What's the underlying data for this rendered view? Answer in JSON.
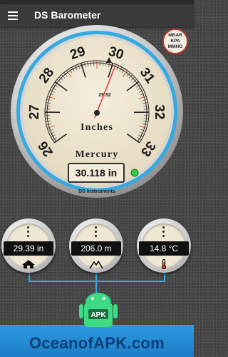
{
  "app_bar": {
    "title": "DS Barometer",
    "menu_icon": "hamburger-menu-icon"
  },
  "units_button": {
    "line1": "MBAR",
    "line2": "KPA",
    "line3": "MMHG"
  },
  "gauge": {
    "scale_labels": [
      "26",
      "27",
      "28",
      "29",
      "30",
      "31",
      "32",
      "33"
    ],
    "unit_line1": "Inches",
    "unit_line2": "Mercury",
    "pointer_value": "29.92",
    "digital_reading": "30.118 in",
    "brand": "DS Instruments",
    "status_led_color": "#2ecc40",
    "bezel_color": "#35a9e0"
  },
  "dials": {
    "pressure": {
      "value": "29.39 in",
      "icon": "home-icon"
    },
    "altitude": {
      "value": "206.0 m",
      "icon": "mountain-icon"
    },
    "temperature": {
      "value": "14.8 °C",
      "icon": "thermometer-icon"
    }
  },
  "watermark": {
    "badge": "APK",
    "text": "OceanofAPK.com"
  }
}
